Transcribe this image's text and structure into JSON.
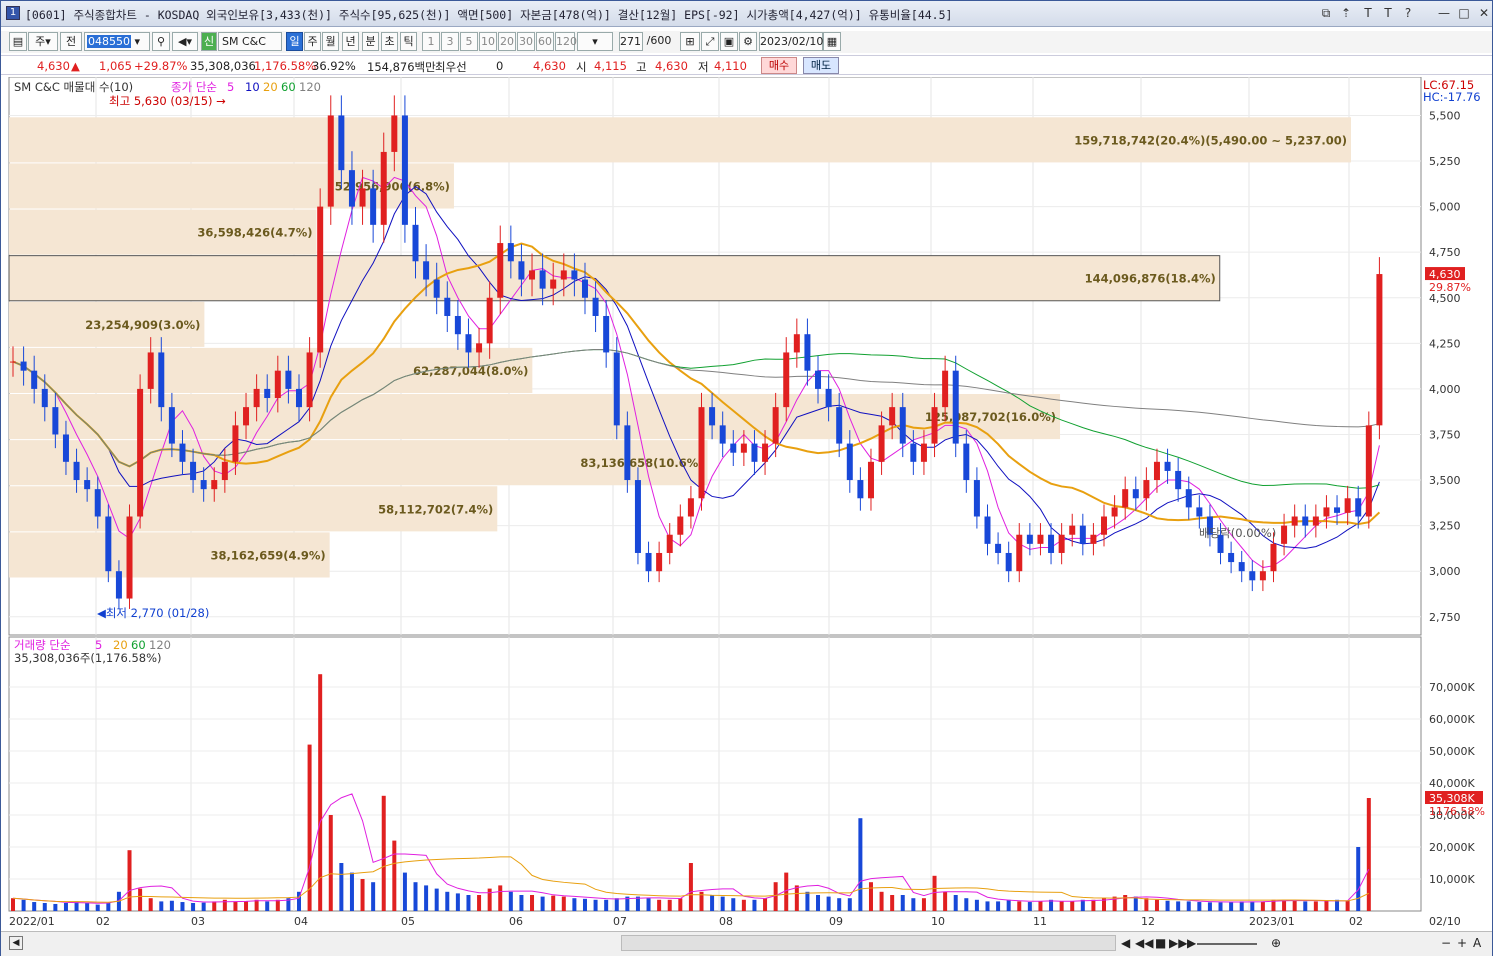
{
  "window": {
    "number": "1",
    "title": "[0601] 주식종합차트 - KOSDAQ 외국인보유[3,433(천)] 주식수[95,625(천)] 액면[500] 자본금[478(억)] 결산[12월] EPS[-92] 시가총액[4,427(억)] 유통비율[44.5]",
    "controls": [
      "⧉",
      "⇡",
      "T",
      "T",
      "?",
      "—",
      "□",
      "✕"
    ]
  },
  "toolbar": {
    "type_sel": "주",
    "prev": "전",
    "code": "048550",
    "name": "SM C&C",
    "badge": "신",
    "periods": [
      "일",
      "주",
      "월",
      "년",
      "분",
      "초",
      "틱"
    ],
    "active_period": "일",
    "multipliers": [
      "1",
      "3",
      "5",
      "10",
      "20",
      "30",
      "60",
      "120"
    ],
    "count": "271",
    "count_total": "/600",
    "date": "2023/02/10"
  },
  "info": {
    "price": "4,630",
    "change": "1,065",
    "change_pct": "+29.87%",
    "volume": "35,308,036",
    "volume_pct": "1,176.58%",
    "turnover": "36.92%",
    "amount": "154,876백만",
    "best_quote_label": "최우선",
    "best_quote_qty": "0",
    "best_quote_price": "4,630",
    "open_label": "시",
    "open": "4,115",
    "high_label": "고",
    "high": "4,630",
    "low_label": "저",
    "low": "4,110",
    "buy": "매수",
    "sell": "매도"
  },
  "chart_data": {
    "type": "candlestick",
    "title": "SM C&C",
    "legend": {
      "vp": "SM C&C 매물대 수(10)",
      "ma_label": "종가 단순",
      "ma": [
        "5",
        "10",
        "20",
        "60",
        "120"
      ],
      "vol_label": "거래량 단순",
      "vol_ma": [
        "5",
        "20",
        "60",
        "120"
      ],
      "vol_now": "35,308,036주(1,176.58%)"
    },
    "price_axis": [
      "5,500",
      "5,250",
      "5,000",
      "4,750",
      "4,500",
      "4,250",
      "4,000",
      "3,750",
      "3,500",
      "3,250",
      "3,000",
      "2,750"
    ],
    "ylim": [
      2650,
      5700
    ],
    "vol_axis": [
      "70,000K",
      "60,000K",
      "50,000K",
      "40,000K",
      "30,000K",
      "20,000K",
      "10,000K"
    ],
    "vol_max": 80000,
    "x_labels": [
      "2022/01",
      "02",
      "03",
      "04",
      "05",
      "06",
      "07",
      "08",
      "09",
      "10",
      "11",
      "12",
      "2023/01",
      "02",
      "02/10"
    ],
    "lc": "LC:67.15",
    "hc": "HC:-17.76",
    "cur_price": "4,630",
    "cur_pct": "29.87%",
    "cur_vol": "35,308K",
    "cur_vol_pct": "1176.58%",
    "max_label": "최고 5,630 (03/15)",
    "min_label": "최저 2,770 (01/28)",
    "exdiv": "배당락(0.00%)",
    "volume_profile": [
      {
        "low": 5237,
        "high": 5490,
        "volume": 159718742,
        "label": "159,718,742(20.4%)(5,490.00 ~ 5,237.00)"
      },
      {
        "low": 4984,
        "high": 5237,
        "volume": 52956906,
        "label": "52,956,906(6.8%)"
      },
      {
        "low": 4731,
        "high": 4984,
        "volume": 36598426,
        "label": "36,598,426(4.7%)"
      },
      {
        "low": 4478,
        "high": 4731,
        "volume": 144096876,
        "label": "144,096,876(18.4%)"
      },
      {
        "low": 4225,
        "high": 4478,
        "volume": 23254909,
        "label": "23,254,909(3.0%)"
      },
      {
        "low": 3972,
        "high": 4225,
        "volume": 62287044,
        "label": "62,287,044(8.0%)"
      },
      {
        "low": 3719,
        "high": 3972,
        "volume": 125087702,
        "label": "125,087,702(16.0%)"
      },
      {
        "low": 3466,
        "high": 3719,
        "volume": 83136658,
        "label": "83,136,658(10.6%)"
      },
      {
        "low": 3213,
        "high": 3466,
        "volume": 58112702,
        "label": "58,112,702(7.4%)"
      },
      {
        "low": 2960,
        "high": 3213,
        "volume": 38162659,
        "label": "38,162,659(4.9%)"
      }
    ],
    "series": {
      "close": [
        4150,
        4100,
        4000,
        3900,
        3750,
        3600,
        3500,
        3450,
        3300,
        3000,
        2850,
        3300,
        4000,
        4200,
        3900,
        3700,
        3600,
        3500,
        3450,
        3500,
        3600,
        3800,
        3900,
        4000,
        3950,
        4100,
        4000,
        3900,
        4200,
        5000,
        5500,
        5200,
        5000,
        5100,
        4900,
        5300,
        5500,
        4900,
        4700,
        4600,
        4500,
        4400,
        4300,
        4200,
        4250,
        4500,
        4800,
        4700,
        4600,
        4650,
        4550,
        4600,
        4650,
        4600,
        4500,
        4400,
        4200,
        3800,
        3500,
        3100,
        3000,
        3100,
        3200,
        3300,
        3400,
        3900,
        3800,
        3700,
        3650,
        3700,
        3600,
        3700,
        3900,
        4200,
        4300,
        4100,
        4000,
        3900,
        3700,
        3500,
        3400,
        3600,
        3800,
        3900,
        3700,
        3600,
        3700,
        3900,
        4100,
        3700,
        3500,
        3300,
        3150,
        3100,
        3000,
        3200,
        3150,
        3200,
        3100,
        3200,
        3250,
        3150,
        3200,
        3300,
        3350,
        3450,
        3400,
        3500,
        3600,
        3550,
        3450,
        3350,
        3300,
        3200,
        3100,
        3050,
        3000,
        2950,
        3000,
        3150,
        3250,
        3300,
        3250,
        3300,
        3350,
        3320,
        3400,
        3300,
        3800,
        4630
      ],
      "volume": [
        4000,
        3500,
        2800,
        2500,
        2200,
        2500,
        3000,
        2500,
        2000,
        2500,
        6000,
        19000,
        7000,
        4000,
        3000,
        3200,
        2800,
        2500,
        2600,
        3000,
        3500,
        3000,
        3000,
        3500,
        3000,
        3500,
        4000,
        6000,
        52000,
        74000,
        30000,
        15000,
        12000,
        10000,
        9000,
        36000,
        22000,
        12000,
        9000,
        8000,
        7000,
        6000,
        5500,
        5000,
        5000,
        7000,
        8000,
        6000,
        5000,
        5000,
        4500,
        4800,
        4500,
        4000,
        3800,
        3500,
        3500,
        4000,
        4500,
        4500,
        4000,
        3500,
        3500,
        4000,
        15000,
        6000,
        5000,
        4500,
        4000,
        3500,
        3500,
        4000,
        9000,
        12000,
        8000,
        6000,
        5000,
        4500,
        4000,
        4000,
        29000,
        9000,
        6000,
        5000,
        5000,
        4000,
        4000,
        11000,
        6000,
        5000,
        4000,
        3500,
        3000,
        3000,
        3500,
        3000,
        2800,
        3000,
        3500,
        3000,
        3000,
        3500,
        3500,
        4000,
        4500,
        5000,
        4500,
        4000,
        3500,
        3200,
        3000,
        3000,
        2800,
        2700,
        2700,
        2800,
        3000,
        3000,
        3000,
        3500,
        3500,
        3200,
        3000,
        3000,
        3200,
        3500,
        3300,
        20000,
        35308
      ]
    }
  },
  "statusbar": {
    "nav": [
      "◀",
      "◀◀",
      "■",
      "▶▶",
      "▶"
    ],
    "zoom_out": "−",
    "zoom_in": "+",
    "font": "A"
  },
  "colors": {
    "up": "#e02020",
    "down": "#1848d8",
    "ma5": "#e020e0",
    "ma10": "#1010c0",
    "ma20": "#e8a010",
    "ma60": "#10a030",
    "ma120": "#808080",
    "profile": "#f5e6d3",
    "profile_text": "#6b5a1e"
  }
}
